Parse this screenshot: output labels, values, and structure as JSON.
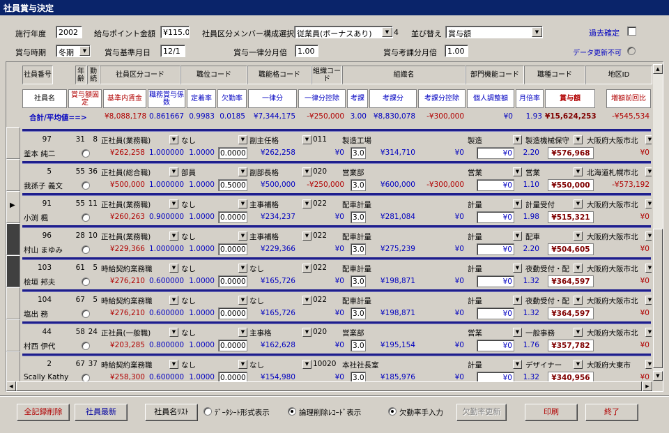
{
  "window": {
    "title": "社員賞与決定"
  },
  "top": {
    "year_label": "施行年度",
    "year_value": "2002",
    "point_label": "給与ポイント金額",
    "point_value": "¥115.0",
    "member_label": "社員区分メンバー構成選択",
    "member_value": "従業員(ボーナスあり)",
    "member_count": "4",
    "sort_label": "並び替え",
    "sort_value": "賞与額",
    "past_label": "過去確定",
    "period_label": "賞与時期",
    "period_value": "冬期",
    "base_date_label": "賞与基準月日",
    "base_date_value": "12/1",
    "flat_month_label": "賞与一律分月倍",
    "flat_month_value": "1.00",
    "eval_month_label": "賞与考課分月倍",
    "eval_month_value": "1.00",
    "no_update_label": "データ更新不可"
  },
  "header1": {
    "emp_no": "社員番号",
    "age": "年齢",
    "tenure": "勤続",
    "emp_class": "社員区分コード",
    "position": "職位コード",
    "grade": "職能格コード",
    "org_code": "組織コード",
    "org_name": "組織名",
    "dept_func": "部門機能コード",
    "job_type": "職種コード",
    "region": "地区ID"
  },
  "header2": {
    "name": "社員名",
    "fixed": "賞与額固定",
    "base": "基準内賃金",
    "coef": "職務賞与係数",
    "rate": "定着率",
    "absence": "欠勤率",
    "flat": "一律分",
    "flat_ded": "一律分控除",
    "eval": "考課",
    "eval_amt": "考課分",
    "eval_ded": "考課分控除",
    "personal": "個人調整額",
    "month_rate": "月倍率",
    "bonus": "賞与額",
    "change": "増額前回比"
  },
  "totals": {
    "label": "合計/平均値==>",
    "base": "¥8,088,178",
    "coef": "0.861667",
    "rate": "0.9983",
    "absence": "0.0185",
    "flat": "¥7,344,175",
    "flat_ded": "-¥250,000",
    "eval": "3.00",
    "eval_amt": "¥8,830,078",
    "eval_ded": "-¥300,000",
    "personal": "¥0",
    "month_rate": "1.93",
    "bonus": "¥15,624,253",
    "change": "-¥545,534"
  },
  "rows": [
    {
      "no": "97",
      "age": "31",
      "tenure": "8",
      "emp_class": "正社員(業務職)",
      "position": "なし",
      "grade": "副主任格",
      "org_code": "011",
      "org_name": "製造工場",
      "dept": "製造",
      "job": "製造機械保守",
      "region": "大阪府大阪市北",
      "name": "釜本 純二",
      "base": "¥262,258",
      "coef": "1.000000",
      "rate": "1.0000",
      "absence": "0.0000",
      "flat": "¥262,258",
      "flat_ded": "¥0",
      "eval": "3.0",
      "eval_amt": "¥314,710",
      "eval_ded": "¥0",
      "personal": "¥0",
      "month_rate": "2.20",
      "bonus": "¥576,968",
      "change": "¥0"
    },
    {
      "no": "5",
      "age": "55",
      "tenure": "36",
      "emp_class": "正社員(総合職)",
      "position": "部員",
      "grade": "副部長格",
      "org_code": "020",
      "org_name": "営業部",
      "dept": "営業",
      "job": "営業",
      "region": "北海道札幌市北",
      "name": "我孫子 義文",
      "base": "¥500,000",
      "coef": "1.000000",
      "rate": "1.0000",
      "absence": "0.5000",
      "flat": "¥500,000",
      "flat_ded": "-¥250,000",
      "eval": "3.0",
      "eval_amt": "¥600,000",
      "eval_ded": "-¥300,000",
      "personal": "¥0",
      "month_rate": "1.10",
      "bonus": "¥550,000",
      "change": "-¥573,192"
    },
    {
      "no": "91",
      "age": "55",
      "tenure": "11",
      "emp_class": "正社員(業務職)",
      "position": "なし",
      "grade": "主事補格",
      "org_code": "022",
      "org_name": "配車計量",
      "dept": "計量",
      "job": "計量受付",
      "region": "大阪府大阪市北",
      "name": "小渕 楓",
      "base": "¥260,263",
      "coef": "0.900000",
      "rate": "1.0000",
      "absence": "0.0000",
      "flat": "¥234,237",
      "flat_ded": "¥0",
      "eval": "3.0",
      "eval_amt": "¥281,084",
      "eval_ded": "¥0",
      "personal": "¥0",
      "month_rate": "1.98",
      "bonus": "¥515,321",
      "change": "¥0"
    },
    {
      "no": "96",
      "age": "28",
      "tenure": "10",
      "emp_class": "正社員(業務職)",
      "position": "なし",
      "grade": "主事補格",
      "org_code": "022",
      "org_name": "配車計量",
      "dept": "計量",
      "job": "配車",
      "region": "大阪府大阪市北",
      "name": "村山 まゆみ",
      "base": "¥229,366",
      "coef": "1.000000",
      "rate": "1.0000",
      "absence": "0.0000",
      "flat": "¥229,366",
      "flat_ded": "¥0",
      "eval": "3.0",
      "eval_amt": "¥275,239",
      "eval_ded": "¥0",
      "personal": "¥0",
      "month_rate": "2.20",
      "bonus": "¥504,605",
      "change": "¥0"
    },
    {
      "no": "103",
      "age": "61",
      "tenure": "5",
      "emp_class": "時給契約業務職",
      "position": "なし",
      "grade": "なし",
      "org_code": "022",
      "org_name": "配車計量",
      "dept": "計量",
      "job": "夜勤受付・配",
      "region": "大阪府大阪市北",
      "name": "桧垣 邦夫",
      "base": "¥276,210",
      "coef": "0.600000",
      "rate": "1.0000",
      "absence": "0.0000",
      "flat": "¥165,726",
      "flat_ded": "¥0",
      "eval": "3.0",
      "eval_amt": "¥198,871",
      "eval_ded": "¥0",
      "personal": "¥0",
      "month_rate": "1.32",
      "bonus": "¥364,597",
      "change": "¥0"
    },
    {
      "no": "104",
      "age": "67",
      "tenure": "5",
      "emp_class": "時給契約業務職",
      "position": "なし",
      "grade": "なし",
      "org_code": "022",
      "org_name": "配車計量",
      "dept": "計量",
      "job": "夜勤受付・配",
      "region": "大阪府大阪市北",
      "name": "塩出 務",
      "base": "¥276,210",
      "coef": "0.600000",
      "rate": "1.0000",
      "absence": "0.0000",
      "flat": "¥165,726",
      "flat_ded": "¥0",
      "eval": "3.0",
      "eval_amt": "¥198,871",
      "eval_ded": "¥0",
      "personal": "¥0",
      "month_rate": "1.32",
      "bonus": "¥364,597",
      "change": "¥0"
    },
    {
      "no": "44",
      "age": "58",
      "tenure": "24",
      "emp_class": "正社員(一般職)",
      "position": "なし",
      "grade": "主事格",
      "org_code": "020",
      "org_name": "営業部",
      "dept": "営業",
      "job": "一般事務",
      "region": "大阪府大阪市北",
      "name": "村西 伊代",
      "base": "¥203,285",
      "coef": "0.800000",
      "rate": "1.0000",
      "absence": "0.0000",
      "flat": "¥162,628",
      "flat_ded": "¥0",
      "eval": "3.0",
      "eval_amt": "¥195,154",
      "eval_ded": "¥0",
      "personal": "¥0",
      "month_rate": "1.76",
      "bonus": "¥357,782",
      "change": "¥0"
    },
    {
      "no": "2",
      "age": "67",
      "tenure": "37",
      "emp_class": "時給契約業務職",
      "position": "なし",
      "grade": "なし",
      "org_code": "10020",
      "org_name": "本社社長室",
      "dept": "計量",
      "job": "デザイナー",
      "region": "大阪府大東市",
      "name": "Scally Kathy",
      "base": "¥258,300",
      "coef": "0.600000",
      "rate": "1.0000",
      "absence": "0.0000",
      "flat": "¥154,980",
      "flat_ded": "¥0",
      "eval": "3.0",
      "eval_amt": "¥185,976",
      "eval_ded": "¥0",
      "personal": "¥0",
      "month_rate": "1.32",
      "bonus": "¥340,956",
      "change": "¥0"
    }
  ],
  "bottom": {
    "delete_all": "全記録削除",
    "refresh": "社員最新",
    "name_list": "社員名ﾘｽﾄ",
    "datasheet": "ﾃﾞｰﾀｼｰﾄ形式表示",
    "logical_delete": "論理削除ﾚｺｰﾄﾞ表示",
    "manual_absence": "欠勤率手入力",
    "update_absence": "欠勤率更新",
    "print": "印刷",
    "exit": "終了"
  }
}
